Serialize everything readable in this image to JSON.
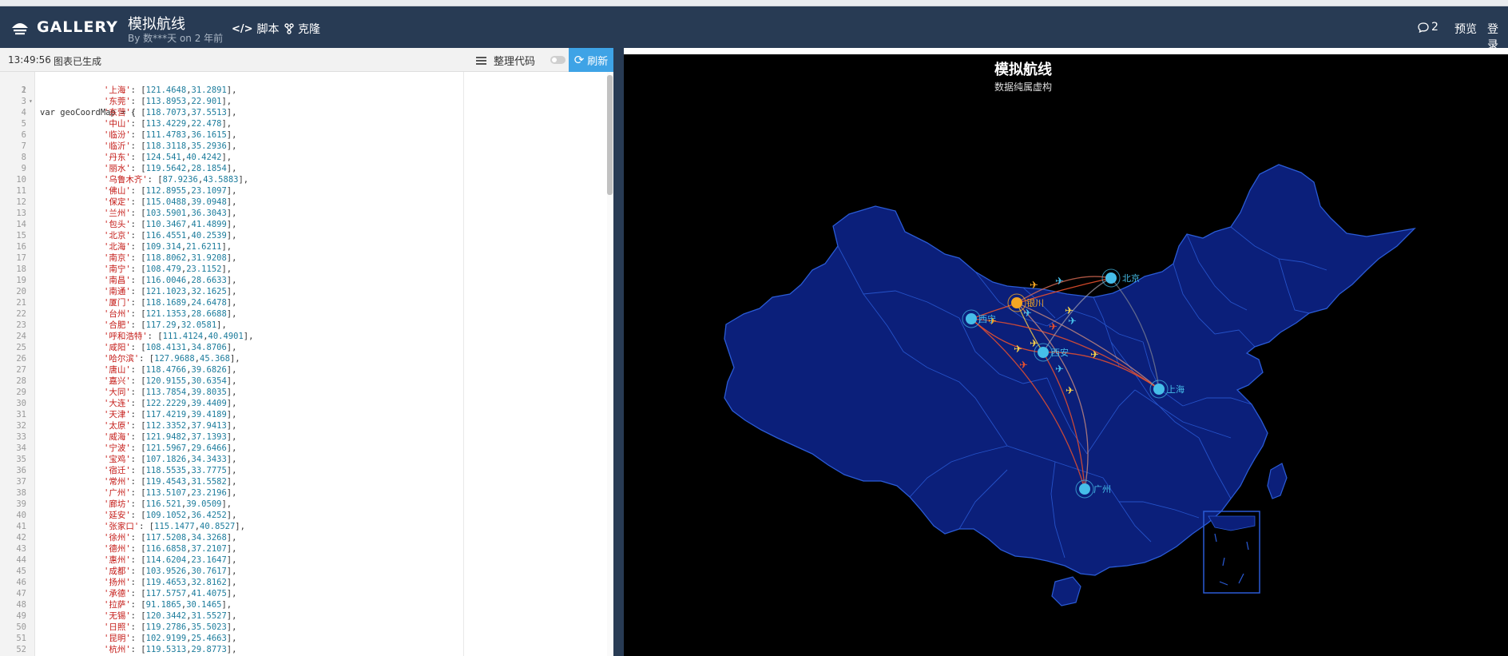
{
  "header": {
    "logo": "GALLERY",
    "title": "模拟航线",
    "byline": "By 数***天 on 2 年前",
    "script_label": "脚本",
    "clone_label": "克隆",
    "comments_count": "2",
    "preview_label": "预览",
    "login_label": "登录"
  },
  "toolbar": {
    "time": "13:49:56",
    "status": "图表已生成",
    "format_label": "整理代码",
    "refresh_label": "刷新"
  },
  "editor": {
    "first_line": "var geoCoordMap = {",
    "entries": [
      {
        "city": "上海",
        "lng": "121.4648",
        "lat": "31.2891"
      },
      {
        "city": "东莞",
        "lng": "113.8953",
        "lat": "22.901"
      },
      {
        "city": "东营",
        "lng": "118.7073",
        "lat": "37.5513"
      },
      {
        "city": "中山",
        "lng": "113.4229",
        "lat": "22.478"
      },
      {
        "city": "临汾",
        "lng": "111.4783",
        "lat": "36.1615"
      },
      {
        "city": "临沂",
        "lng": "118.3118",
        "lat": "35.2936"
      },
      {
        "city": "丹东",
        "lng": "124.541",
        "lat": "40.4242"
      },
      {
        "city": "丽水",
        "lng": "119.5642",
        "lat": "28.1854"
      },
      {
        "city": "乌鲁木齐",
        "lng": "87.9236",
        "lat": "43.5883"
      },
      {
        "city": "佛山",
        "lng": "112.8955",
        "lat": "23.1097"
      },
      {
        "city": "保定",
        "lng": "115.0488",
        "lat": "39.0948"
      },
      {
        "city": "兰州",
        "lng": "103.5901",
        "lat": "36.3043"
      },
      {
        "city": "包头",
        "lng": "110.3467",
        "lat": "41.4899"
      },
      {
        "city": "北京",
        "lng": "116.4551",
        "lat": "40.2539"
      },
      {
        "city": "北海",
        "lng": "109.314",
        "lat": "21.6211"
      },
      {
        "city": "南京",
        "lng": "118.8062",
        "lat": "31.9208"
      },
      {
        "city": "南宁",
        "lng": "108.479",
        "lat": "23.1152"
      },
      {
        "city": "南昌",
        "lng": "116.0046",
        "lat": "28.6633"
      },
      {
        "city": "南通",
        "lng": "121.1023",
        "lat": "32.1625"
      },
      {
        "city": "厦门",
        "lng": "118.1689",
        "lat": "24.6478"
      },
      {
        "city": "台州",
        "lng": "121.1353",
        "lat": "28.6688"
      },
      {
        "city": "合肥",
        "lng": "117.29",
        "lat": "32.0581"
      },
      {
        "city": "呼和浩特",
        "lng": "111.4124",
        "lat": "40.4901"
      },
      {
        "city": "咸阳",
        "lng": "108.4131",
        "lat": "34.8706"
      },
      {
        "city": "哈尔滨",
        "lng": "127.9688",
        "lat": "45.368"
      },
      {
        "city": "唐山",
        "lng": "118.4766",
        "lat": "39.6826"
      },
      {
        "city": "嘉兴",
        "lng": "120.9155",
        "lat": "30.6354"
      },
      {
        "city": "大同",
        "lng": "113.7854",
        "lat": "39.8035"
      },
      {
        "city": "大连",
        "lng": "122.2229",
        "lat": "39.4409"
      },
      {
        "city": "天津",
        "lng": "117.4219",
        "lat": "39.4189"
      },
      {
        "city": "太原",
        "lng": "112.3352",
        "lat": "37.9413"
      },
      {
        "city": "威海",
        "lng": "121.9482",
        "lat": "37.1393"
      },
      {
        "city": "宁波",
        "lng": "121.5967",
        "lat": "29.6466"
      },
      {
        "city": "宝鸡",
        "lng": "107.1826",
        "lat": "34.3433"
      },
      {
        "city": "宿迁",
        "lng": "118.5535",
        "lat": "33.7775"
      },
      {
        "city": "常州",
        "lng": "119.4543",
        "lat": "31.5582"
      },
      {
        "city": "广州",
        "lng": "113.5107",
        "lat": "23.2196"
      },
      {
        "city": "廊坊",
        "lng": "116.521",
        "lat": "39.0509"
      },
      {
        "city": "延安",
        "lng": "109.1052",
        "lat": "36.4252"
      },
      {
        "city": "张家口",
        "lng": "115.1477",
        "lat": "40.8527"
      },
      {
        "city": "徐州",
        "lng": "117.5208",
        "lat": "34.3268"
      },
      {
        "city": "德州",
        "lng": "116.6858",
        "lat": "37.2107"
      },
      {
        "city": "惠州",
        "lng": "114.6204",
        "lat": "23.1647"
      },
      {
        "city": "成都",
        "lng": "103.9526",
        "lat": "30.7617"
      },
      {
        "city": "扬州",
        "lng": "119.4653",
        "lat": "32.8162"
      },
      {
        "city": "承德",
        "lng": "117.5757",
        "lat": "41.4075"
      },
      {
        "city": "拉萨",
        "lng": "91.1865",
        "lat": "30.1465"
      },
      {
        "city": "无锡",
        "lng": "120.3442",
        "lat": "31.5527"
      },
      {
        "city": "日照",
        "lng": "119.2786",
        "lat": "35.5023"
      },
      {
        "city": "昆明",
        "lng": "102.9199",
        "lat": "25.4663"
      },
      {
        "city": "杭州",
        "lng": "119.5313",
        "lat": "29.8773"
      }
    ]
  },
  "map": {
    "title": "模拟航线",
    "subtitle": "数据纯属虚构",
    "colors": {
      "background": "#000000",
      "land": "#0b1f7a",
      "border": "#2a5bd6",
      "node": "#46bee9",
      "hub": "#f5a623",
      "route_red": "#e8502e",
      "route_yellow": "#f5d04a"
    },
    "cities": [
      {
        "name": "北京",
        "type": "node"
      },
      {
        "name": "银川",
        "type": "hub"
      },
      {
        "name": "西宁",
        "type": "node"
      },
      {
        "name": "西安",
        "type": "node"
      },
      {
        "name": "上海",
        "type": "node"
      },
      {
        "name": "广州",
        "type": "node"
      }
    ]
  }
}
